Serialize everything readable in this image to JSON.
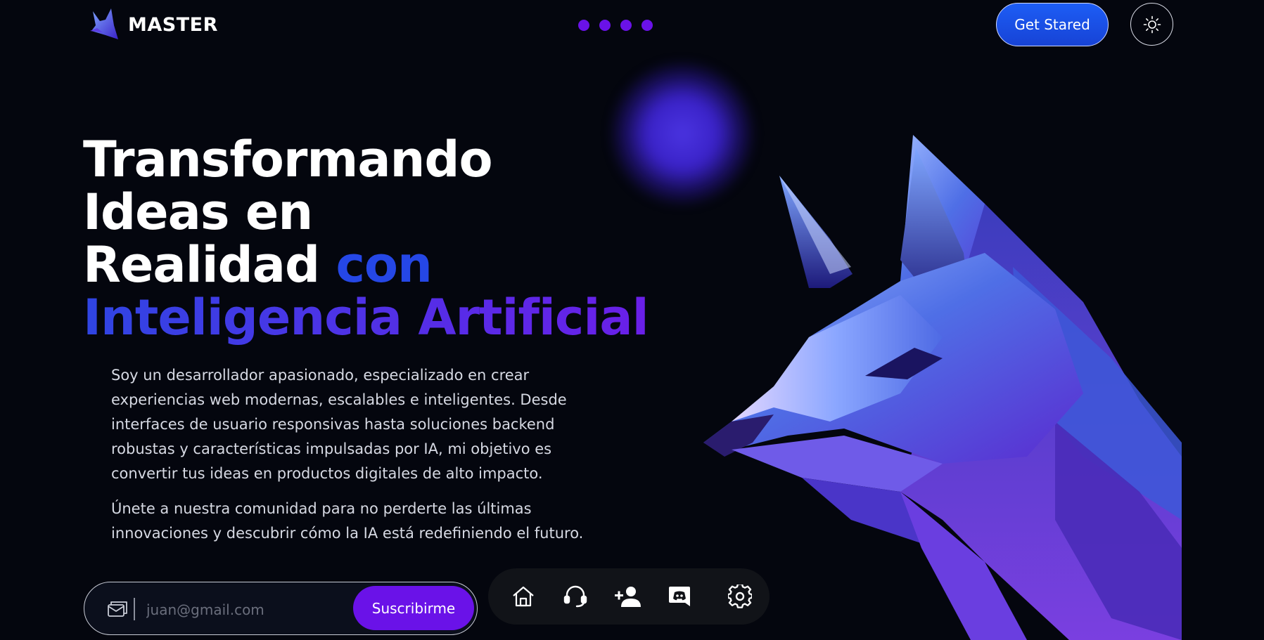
{
  "brand": {
    "name": "MASTER",
    "logo_icon": "fox-logo-icon"
  },
  "header": {
    "carousel_dots": 4,
    "cta_label": "Get Stared",
    "theme_icon": "sun-icon"
  },
  "hero": {
    "title_line1": "Transformando",
    "title_line2": "Ideas en",
    "title_line3_white": "Realidad",
    "title_line3_accent": "con",
    "title_line4": "Inteligencia Artificial",
    "paragraph1": "Soy un desarrollador apasionado, especializado en crear experiencias web modernas, escalables e inteligentes. Desde interfaces de usuario responsivas hasta soluciones backend robustas y características impulsadas por IA, mi objetivo es convertir tus ideas en productos digitales de alto impacto.",
    "paragraph2": "Únete a nuestra comunidad para no perderte las últimas innovaciones y descubrir cómo la IA está redefiniendo el futuro."
  },
  "subscribe": {
    "icon": "mail-icon",
    "placeholder": "juan@gmail.com",
    "button_label": "Suscribirme"
  },
  "dock": {
    "items": [
      {
        "icon": "home-icon"
      },
      {
        "icon": "headset-icon"
      },
      {
        "icon": "add-user-icon"
      },
      {
        "icon": "discord-icon"
      },
      {
        "icon": "gear-icon"
      }
    ]
  },
  "colors": {
    "background": "#04060e",
    "accent_purple": "#6a12e8",
    "accent_blue": "#1d5df5",
    "title_accent_blue": "#2547e6"
  }
}
